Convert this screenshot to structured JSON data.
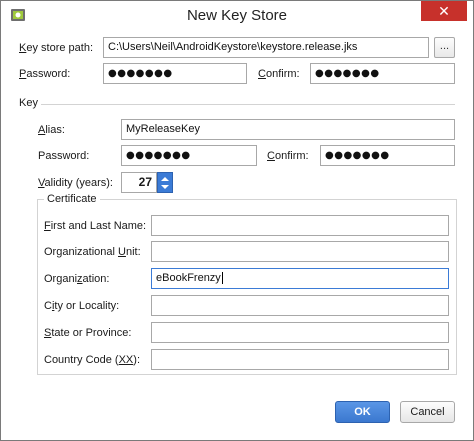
{
  "window": {
    "title": "New Key Store",
    "close_glyph": "✕",
    "app_icon": "android-icon"
  },
  "keystore": {
    "path_label_pre": "",
    "path_label_u": "K",
    "path_label_post": "ey store path:",
    "path_value": "C:\\Users\\Neil\\AndroidKeystore\\keystore.release.jks",
    "browse_label": "...",
    "password_label_pre": "",
    "password_label_u": "P",
    "password_label_post": "assword:",
    "password_value": "●●●●●●●",
    "confirm_label_pre": "",
    "confirm_label_u": "C",
    "confirm_label_post": "onfirm:",
    "confirm_value": "●●●●●●●"
  },
  "key": {
    "group_label": "Key",
    "alias_label_pre": "",
    "alias_label_u": "A",
    "alias_label_post": "lias:",
    "alias_value": "MyReleaseKey",
    "password_label": "Password:",
    "password_value": "●●●●●●●",
    "confirm_label_pre": "",
    "confirm_label_u": "C",
    "confirm_label_post": "onfirm:",
    "confirm_value": "●●●●●●●",
    "validity_label_pre": "",
    "validity_label_u": "V",
    "validity_label_post": "alidity (years):",
    "validity_value": "27"
  },
  "certificate": {
    "group_label": "Certificate",
    "first_last_label_pre": "",
    "first_last_label_u": "F",
    "first_last_label_post": "irst and Last Name:",
    "first_last_value": "",
    "org_unit_label_pre": "Organizational ",
    "org_unit_label_u": "U",
    "org_unit_label_post": "nit:",
    "org_unit_value": "",
    "org_label_pre": "Organi",
    "org_label_u": "z",
    "org_label_post": "ation:",
    "org_value": "eBookFrenzy",
    "city_label_pre": "C",
    "city_label_u": "i",
    "city_label_post": "ty or Locality:",
    "city_value": "",
    "state_label_pre": "",
    "state_label_u": "S",
    "state_label_post": "tate or Province:",
    "state_value": "",
    "country_label_pre": "Country Code (",
    "country_label_u": "XX",
    "country_label_post": "):",
    "country_value": ""
  },
  "buttons": {
    "ok_label": "OK",
    "cancel_label": "Cancel"
  },
  "colors": {
    "accent": "#3b7bd6",
    "close": "#c7312b"
  }
}
